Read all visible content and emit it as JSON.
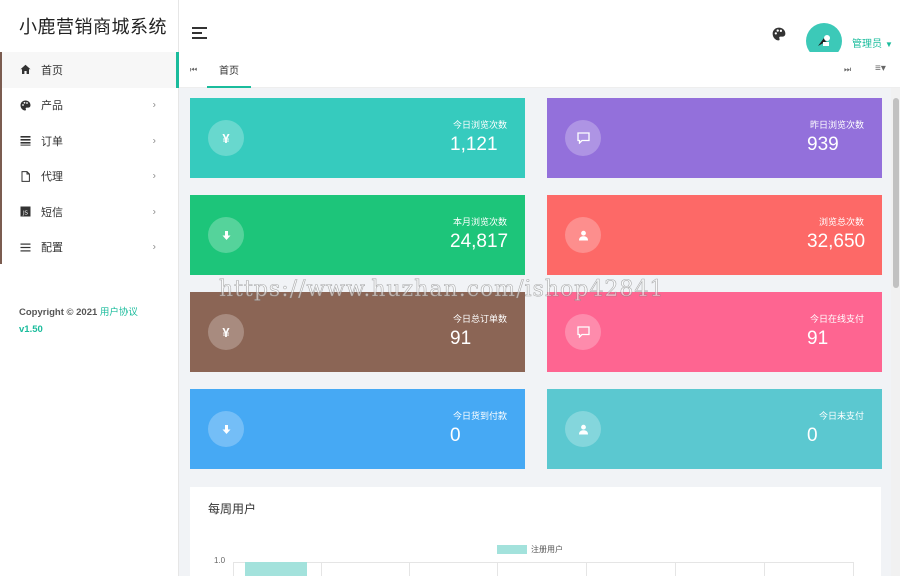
{
  "app": {
    "title": "小鹿营销商城系统"
  },
  "sidebar": {
    "items": [
      {
        "label": "首页",
        "icon": "home-icon"
      },
      {
        "label": "产品",
        "icon": "palette-icon"
      },
      {
        "label": "订单",
        "icon": "list-icon"
      },
      {
        "label": "代理",
        "icon": "file-icon"
      },
      {
        "label": "短信",
        "icon": "js-icon"
      },
      {
        "label": "配置",
        "icon": "menu-icon"
      }
    ],
    "copyright": "Copyright © 2021",
    "agreement": "用户协议",
    "version": "v1.50"
  },
  "header": {
    "admin_label": "管理员"
  },
  "tabs": [
    {
      "label": "首页"
    }
  ],
  "cards": [
    {
      "label": "今日浏览次数",
      "value": "1,121",
      "icon": "yen-icon",
      "color": "#36cbbe"
    },
    {
      "label": "昨日浏览次数",
      "value": "939",
      "icon": "message-icon",
      "color": "#9370db"
    },
    {
      "label": "本月浏览次数",
      "value": "24,817",
      "icon": "download-icon",
      "color": "#1dc57a"
    },
    {
      "label": "浏览总次数",
      "value": "32,650",
      "icon": "user-icon",
      "color": "#fd6967"
    },
    {
      "label": "今日总订单数",
      "value": "91",
      "icon": "yen-icon",
      "color": "#8b6555"
    },
    {
      "label": "今日在线支付",
      "value": "91",
      "icon": "message-icon",
      "color": "#fe6591"
    },
    {
      "label": "今日货到付款",
      "value": "0",
      "icon": "download-icon",
      "color": "#46a9f4"
    },
    {
      "label": "今日未支付",
      "value": "0",
      "icon": "user-icon",
      "color": "#5bc8d0"
    }
  ],
  "weekly": {
    "title": "每周用户",
    "chart_data": {
      "type": "bar",
      "series": [
        {
          "name": "注册用户",
          "values": [
            1.0
          ]
        }
      ],
      "yticks": [
        "1.0"
      ],
      "color": "#a3e2dc"
    }
  },
  "watermark": "https://www.huzhan.com/ishop42841"
}
